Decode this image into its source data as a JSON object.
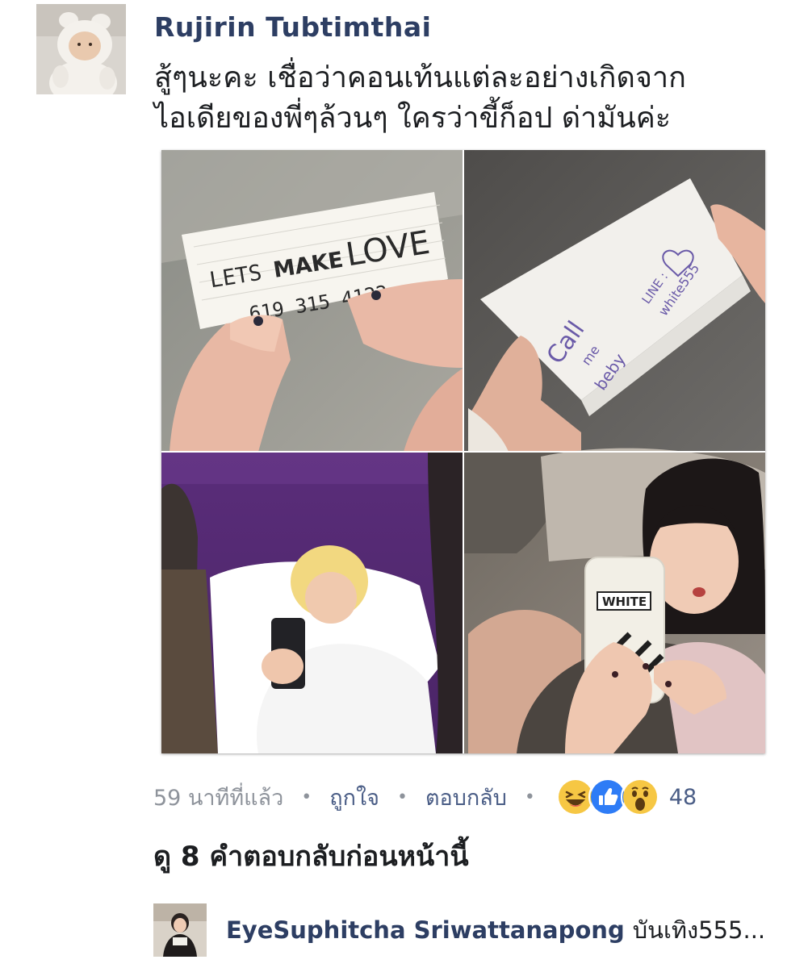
{
  "comment": {
    "author": "Rujirin Tubtimthai",
    "text_line1": "สู้ๆนะคะ เชื่อว่าคอนเท้นแต่ละอย่างเกิดจาก",
    "text_line2": "ไอเดียของพี่ๆล้วนๆ ใครว่าขี้ก็อป ด่ามันค่ะ",
    "photo_collage": {
      "note_top_left": {
        "line1_a": "LETS",
        "line1_b": "MAKE",
        "line1_c": "LOVE",
        "line2": "619 315 4122"
      },
      "note_top_right": {
        "text1": "Call",
        "text2": "me",
        "text3": "beby",
        "text4": "LINE :",
        "text5": "white555"
      },
      "phone_case_text": "WHITE"
    },
    "meta": {
      "time": "59 นาทีที่แล้ว",
      "like_label": "ถูกใจ",
      "reply_label": "ตอบกลับ",
      "separator": "•",
      "reactions": [
        "haha-reaction",
        "like-reaction",
        "wow-reaction"
      ],
      "reaction_count": "48"
    },
    "view_previous_replies": "ดู 8 คำตอบกลับก่อนหน้านี้"
  },
  "reply": {
    "author": "EyeSuphitcha Sriwattanapong",
    "text": "บันเทิง555..."
  },
  "colors": {
    "name": "#2d3e63",
    "link": "#4a5d86",
    "muted": "#8e939b",
    "like_blue": "#2e7cf6",
    "emoji_yellow": "#f6c744"
  }
}
